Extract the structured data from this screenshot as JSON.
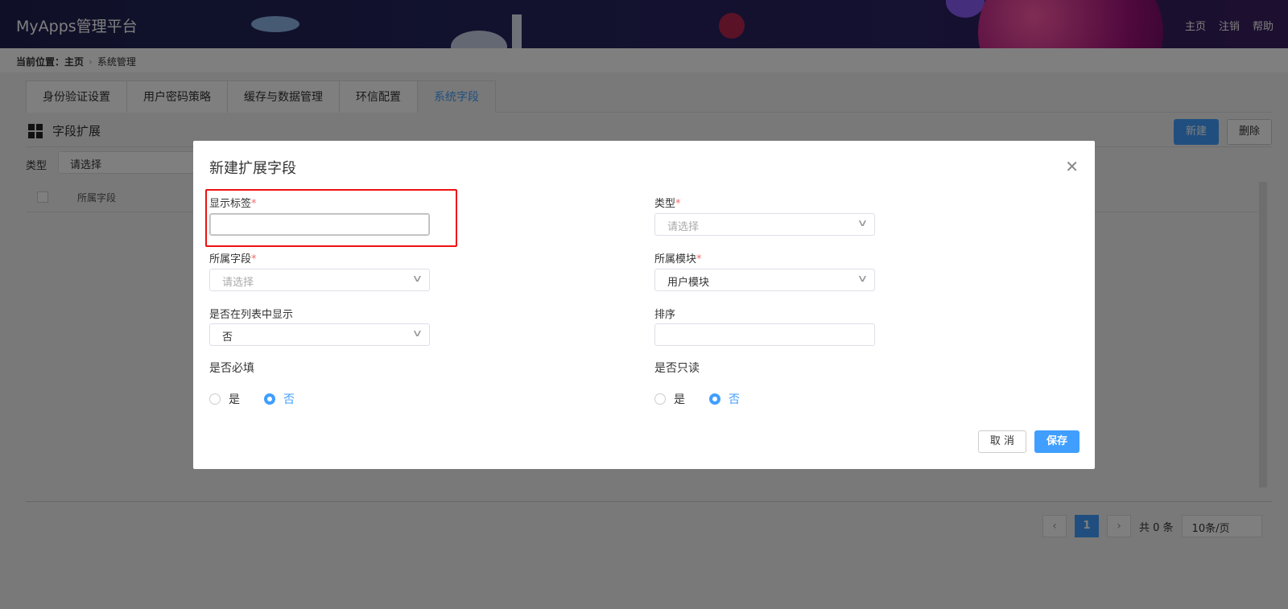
{
  "header": {
    "brand": "MyApps管理平台",
    "nav": [
      "主页",
      "注销",
      "帮助"
    ]
  },
  "breadcrumb": {
    "prefix": "当前位置：",
    "home": "主页",
    "current": "系统管理"
  },
  "tabs": [
    {
      "label": "身份验证设置",
      "active": false
    },
    {
      "label": "用户密码策略",
      "active": false
    },
    {
      "label": "缓存与数据管理",
      "active": false
    },
    {
      "label": "环信配置",
      "active": false
    },
    {
      "label": "系统字段",
      "active": true
    }
  ],
  "section": {
    "title": "字段扩展",
    "new_label": "新建",
    "delete_label": "删除"
  },
  "filter": {
    "type_label": "类型",
    "type_placeholder": "请选择"
  },
  "table": {
    "columns": [
      "所属字段"
    ]
  },
  "pager": {
    "current_page": "1",
    "total": "共 0 条",
    "page_size": "10条/页"
  },
  "dialog": {
    "title": "新建扩展字段",
    "fields": {
      "display_label": {
        "label": "显示标签",
        "value": ""
      },
      "type": {
        "label": "类型",
        "placeholder": "请选择"
      },
      "field": {
        "label": "所属字段",
        "placeholder": "请选择"
      },
      "module": {
        "label": "所属模块",
        "value": "用户模块"
      },
      "show_in_list": {
        "label": "是否在列表中显示",
        "value": "否"
      },
      "sort": {
        "label": "排序",
        "value": ""
      },
      "required": {
        "label": "是否必填",
        "options": [
          "是",
          "否"
        ],
        "selected": "否"
      },
      "readonly": {
        "label": "是否只读",
        "options": [
          "是",
          "否"
        ],
        "selected": "否"
      }
    },
    "required_mark": "*",
    "cancel_label": "取 消",
    "save_label": "保存"
  },
  "colors": {
    "accent": "#409eff",
    "highlight": "#e11111",
    "required": "#f56c6c"
  }
}
